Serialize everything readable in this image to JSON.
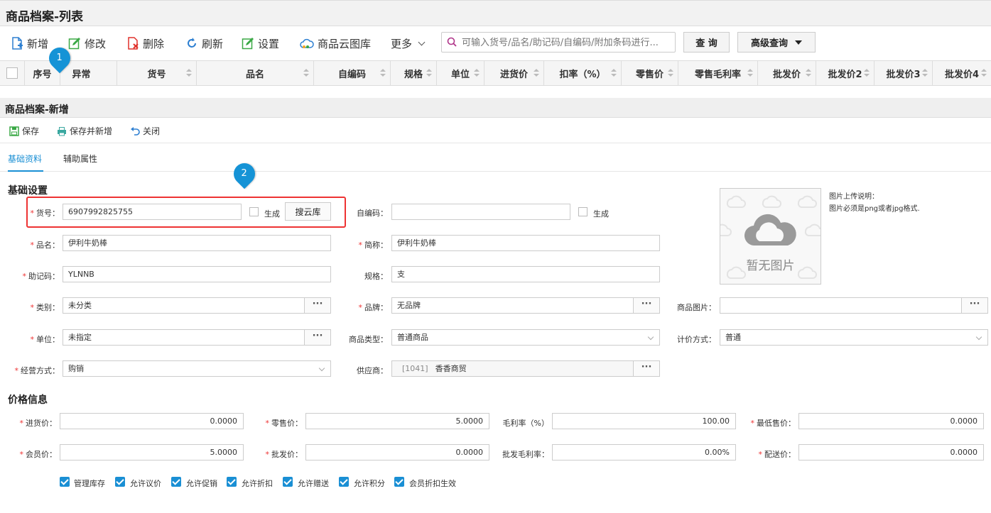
{
  "list": {
    "title": "商品档案-列表",
    "toolbar": {
      "add": "新增",
      "edit": "修改",
      "delete": "删除",
      "refresh": "刷新",
      "settings": "设置",
      "cloud_gallery": "商品云图库",
      "more": "更多"
    },
    "search": {
      "placeholder": "可输入货号/品名/助记码/自编码/附加条码进行..."
    },
    "query_button": "查 询",
    "advanced_button": "高级查询",
    "columns": [
      "序号",
      "异常",
      "货号",
      "品名",
      "自编码",
      "规格",
      "单位",
      "进货价",
      "扣率（%）",
      "零售价",
      "零售毛利率",
      "批发价",
      "批发价2",
      "批发价3",
      "批发价4"
    ]
  },
  "form": {
    "title": "商品档案-新增",
    "toolbar": {
      "save": "保存",
      "save_and_new": "保存并新增",
      "close": "关闭"
    },
    "tabs": [
      "基础资料",
      "辅助属性"
    ],
    "basic_section": "基础设置",
    "price_section": "价格信息",
    "fields": {
      "sku_label": "货号：",
      "sku_value": "6907992825755",
      "generate": "生成",
      "search_cloud": "搜云库",
      "selfcode_label": "自编码：",
      "selfcode_value": "",
      "name_label": "品名：",
      "name_value": "伊利牛奶棒",
      "short_label": "简称：",
      "short_value": "伊利牛奶棒",
      "mnemonic_label": "助记码：",
      "mnemonic_value": "YLNNB",
      "spec_label": "规格：",
      "spec_value": "支",
      "category_label": "类别：",
      "category_value": "未分类",
      "brand_label": "品牌：",
      "brand_value": "无品牌",
      "image_label": "商品图片：",
      "image_value": "",
      "unit_label": "单位：",
      "unit_value": "未指定",
      "type_label": "商品类型：",
      "type_value": "普通商品",
      "pricing_label": "计价方式：",
      "pricing_value": "普通",
      "mode_label": "经营方式：",
      "mode_value": "购销",
      "supplier_label": "供应商：",
      "supplier_code": "[1041]",
      "supplier_value": "香香商贸",
      "dots": "···"
    },
    "image": {
      "placeholder": "暂无图片",
      "note_title": "图片上传说明：",
      "note_body": "图片必须是png或者jpg格式."
    },
    "prices": {
      "purchase_label": "进货价：",
      "purchase_value": "0.0000",
      "retail_label": "零售价：",
      "retail_value": "5.0000",
      "margin_label": "毛利率（%）",
      "margin_value": "100.00",
      "minsale_label": "最低售价：",
      "minsale_value": "0.0000",
      "member_label": "会员价：",
      "member_value": "5.0000",
      "wholesale_label": "批发价：",
      "wholesale_value": "0.0000",
      "wmargin_label": "批发毛利率：",
      "wmargin_value": "0.00%",
      "delivery_label": "配送价：",
      "delivery_value": "0.0000"
    },
    "options": [
      "管理库存",
      "允许议价",
      "允许促销",
      "允许折扣",
      "允许赠送",
      "允许积分",
      "会员折扣生效"
    ]
  },
  "markers": [
    "1",
    "2"
  ],
  "colors": {
    "accent": "#1a8fd4",
    "highlight": "#e33333",
    "marker": "#1593d6"
  }
}
